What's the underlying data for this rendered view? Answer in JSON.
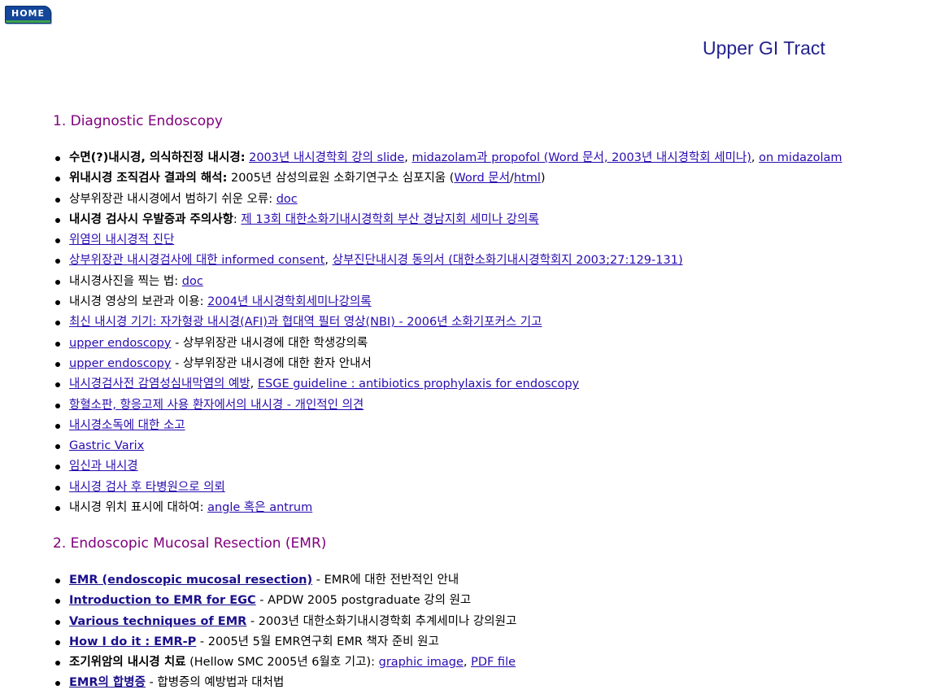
{
  "header": {
    "home_label": "HOME",
    "page_title": "Upper GI Tract"
  },
  "sections": [
    {
      "title": "1. Diagnostic Endoscopy",
      "items": [
        {
          "segments": [
            {
              "t": "b",
              "text": "수면(?)내시경, 의식하진정 내시경:"
            },
            {
              "t": "p",
              "text": " "
            },
            {
              "t": "a",
              "text": "2003년 내시경학회 강의 slide"
            },
            {
              "t": "p",
              "text": ", "
            },
            {
              "t": "a",
              "text": "midazolam과 propofol (Word 문서, 2003년 내시경학회 세미나)"
            },
            {
              "t": "p",
              "text": ", "
            },
            {
              "t": "a",
              "text": "on midazolam"
            }
          ]
        },
        {
          "segments": [
            {
              "t": "b",
              "text": "위내시경 조직검사 결과의 해석:"
            },
            {
              "t": "p",
              "text": " 2005년 삼성의료원 소화기연구소 심포지움 ("
            },
            {
              "t": "a",
              "text": "Word 문서"
            },
            {
              "t": "p",
              "text": "/"
            },
            {
              "t": "a",
              "text": "html"
            },
            {
              "t": "p",
              "text": ")"
            }
          ]
        },
        {
          "segments": [
            {
              "t": "p",
              "text": "상부위장관 내시경에서 범하기 쉬운 오류: "
            },
            {
              "t": "a",
              "text": "doc"
            }
          ]
        },
        {
          "segments": [
            {
              "t": "b",
              "text": "내시경 검사시 우발증과 주의사항"
            },
            {
              "t": "p",
              "text": ": "
            },
            {
              "t": "a",
              "text": "제 13회 대한소화기내시경학회 부산 경남지회 세미나 강의록"
            }
          ]
        },
        {
          "segments": [
            {
              "t": "a",
              "text": "위염의 내시경적 진단"
            }
          ]
        },
        {
          "segments": [
            {
              "t": "a",
              "text": "상부위장관 내시경검사에 대한 informed consent"
            },
            {
              "t": "p",
              "text": ", "
            },
            {
              "t": "a",
              "text": "상부진단내시경 동의서 (대한소화기내시경학회지 2003;27:129-131)"
            }
          ]
        },
        {
          "segments": [
            {
              "t": "p",
              "text": "내시경사진을 찍는 법: "
            },
            {
              "t": "a",
              "text": "doc"
            }
          ]
        },
        {
          "segments": [
            {
              "t": "p",
              "text": "내시경 영상의 보관과 이용: "
            },
            {
              "t": "a",
              "text": "2004년 내시경학회세미나강의록"
            }
          ]
        },
        {
          "segments": [
            {
              "t": "a",
              "text": "최신 내시경 기기: 자가형광 내시경(AFI)과 협대역 필터 영상(NBI) - 2006년 소화기포커스 기고"
            }
          ]
        },
        {
          "segments": [
            {
              "t": "a",
              "text": "upper endoscopy"
            },
            {
              "t": "p",
              "text": " - 상부위장관 내시경에 대한 학생강의록"
            }
          ]
        },
        {
          "segments": [
            {
              "t": "a",
              "text": "upper endoscopy"
            },
            {
              "t": "p",
              "text": " - 상부위장관 내시경에 대한 환자 안내서"
            }
          ]
        },
        {
          "segments": [
            {
              "t": "a",
              "text": "내시경검사전 감염성심내막염의 예방"
            },
            {
              "t": "p",
              "text": ", "
            },
            {
              "t": "a",
              "text": "ESGE guideline : antibiotics prophylaxis for endoscopy"
            }
          ]
        },
        {
          "segments": [
            {
              "t": "a",
              "text": "항혈소판, 항응고제 사용 환자에서의 내시경 - 개인적인 의견"
            }
          ]
        },
        {
          "segments": [
            {
              "t": "a",
              "text": "내시경소독에 대한 소고"
            }
          ]
        },
        {
          "segments": [
            {
              "t": "a",
              "text": "Gastric Varix"
            }
          ]
        },
        {
          "segments": [
            {
              "t": "a",
              "text": "임신과 내시경"
            }
          ]
        },
        {
          "segments": [
            {
              "t": "a",
              "text": "내시경 검사 후 타병원으로 의뢰"
            }
          ]
        },
        {
          "segments": [
            {
              "t": "p",
              "text": "내시경 위치 표시에 대하여: "
            },
            {
              "t": "a",
              "text": "angle 혹은 antrum"
            }
          ]
        }
      ]
    },
    {
      "title": "2. Endoscopic Mucosal Resection (EMR)",
      "items": [
        {
          "segments": [
            {
              "t": "ab",
              "text": "EMR (endoscopic mucosal resection)"
            },
            {
              "t": "p",
              "text": " - EMR에 대한 전반적인 안내"
            }
          ]
        },
        {
          "segments": [
            {
              "t": "ab",
              "text": "Introduction to EMR for EGC"
            },
            {
              "t": "p",
              "text": " - APDW 2005 postgraduate 강의 원고"
            }
          ]
        },
        {
          "segments": [
            {
              "t": "ab",
              "text": "Various techniques of EMR"
            },
            {
              "t": "p",
              "text": " - 2003년 대한소화기내시경학회 추계세미나 강의원고"
            }
          ]
        },
        {
          "segments": [
            {
              "t": "ab",
              "text": "How I do it : EMR-P"
            },
            {
              "t": "p",
              "text": " - 2005년 5월 EMR연구회 EMR 책자 준비 원고"
            }
          ]
        },
        {
          "segments": [
            {
              "t": "b",
              "text": "조기위암의 내시경 치료"
            },
            {
              "t": "p",
              "text": " (Hellow SMC 2005년 6월호 기고): "
            },
            {
              "t": "a",
              "text": "graphic image"
            },
            {
              "t": "p",
              "text": ", "
            },
            {
              "t": "a",
              "text": "PDF file"
            }
          ]
        },
        {
          "segments": [
            {
              "t": "ab",
              "text": "EMR의 합병증"
            },
            {
              "t": "p",
              "text": " - 합병증의 예방법과 대처법"
            }
          ]
        }
      ]
    }
  ]
}
